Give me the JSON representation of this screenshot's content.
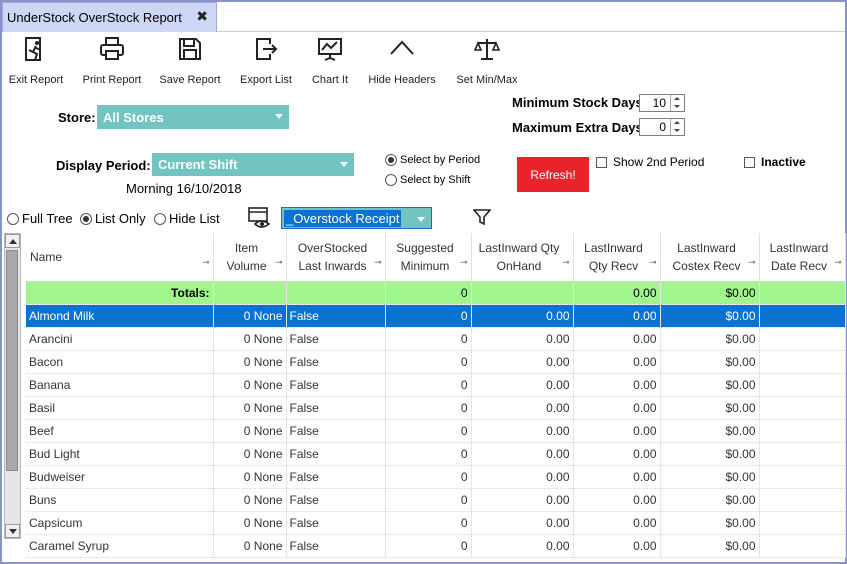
{
  "tab": {
    "title": "UnderStock OverStock Report",
    "close": "✖"
  },
  "toolbar": [
    {
      "label": "Exit Report",
      "icon": "exit-icon"
    },
    {
      "label": "Print Report",
      "icon": "printer-icon"
    },
    {
      "label": "Save Report",
      "icon": "save-icon"
    },
    {
      "label": "Export List",
      "icon": "export-icon"
    },
    {
      "label": "Chart It",
      "icon": "chart-icon"
    },
    {
      "label": "Hide Headers",
      "icon": "chevron-up-icon"
    },
    {
      "label": "Set Min/Max",
      "icon": "scales-icon"
    }
  ],
  "store": {
    "label": "Store:",
    "value": "All Stores"
  },
  "display_period": {
    "label": "Display Period:",
    "value": "Current Shift",
    "shift_text": "Morning 16/10/2018"
  },
  "min_stock_days": {
    "label": "Minimum Stock Days",
    "value": "10"
  },
  "max_extra_days": {
    "label": "Maximum Extra Days",
    "value": "0"
  },
  "period_mode": {
    "by_period": "Select by Period",
    "by_shift": "Select by Shift",
    "selected": "by_period"
  },
  "refresh_label": "Refresh!",
  "show_2nd_period": "Show 2nd Period",
  "inactive": "Inactive",
  "view_mode": {
    "full_tree": "Full Tree",
    "list_only": "List Only",
    "hide_list": "Hide List",
    "selected": "list_only"
  },
  "report_select": {
    "value": "_Overstock Receipt"
  },
  "colors": {
    "accent": "#72c4c2",
    "selection": "#0a73d2",
    "totals": "#a1f58d",
    "refresh": "#e8232b"
  },
  "grid": {
    "columns": [
      "Name",
      "Item Volume",
      "OverStocked Last Inwards",
      "Suggested Minimum",
      "LastInward Qty OnHand",
      "LastInward Qty Recv",
      "LastInward Costex Recv",
      "LastInward Date Recv"
    ],
    "totals": {
      "label": "Totals:",
      "suggested_min": "0",
      "qty_recv": "0.00",
      "costex_recv": "$0.00"
    },
    "rows": [
      {
        "name": "Almond Milk",
        "volume": "0 None",
        "overstocked": "False",
        "sugg_min": "0",
        "qty_onhand": "0.00",
        "qty_recv": "0.00",
        "costex": "$0.00",
        "date": ""
      },
      {
        "name": "Arancini",
        "volume": "0 None",
        "overstocked": "False",
        "sugg_min": "0",
        "qty_onhand": "0.00",
        "qty_recv": "0.00",
        "costex": "$0.00",
        "date": ""
      },
      {
        "name": "Bacon",
        "volume": "0 None",
        "overstocked": "False",
        "sugg_min": "0",
        "qty_onhand": "0.00",
        "qty_recv": "0.00",
        "costex": "$0.00",
        "date": ""
      },
      {
        "name": "Banana",
        "volume": "0 None",
        "overstocked": "False",
        "sugg_min": "0",
        "qty_onhand": "0.00",
        "qty_recv": "0.00",
        "costex": "$0.00",
        "date": ""
      },
      {
        "name": "Basil",
        "volume": "0 None",
        "overstocked": "False",
        "sugg_min": "0",
        "qty_onhand": "0.00",
        "qty_recv": "0.00",
        "costex": "$0.00",
        "date": ""
      },
      {
        "name": "Beef",
        "volume": "0 None",
        "overstocked": "False",
        "sugg_min": "0",
        "qty_onhand": "0.00",
        "qty_recv": "0.00",
        "costex": "$0.00",
        "date": ""
      },
      {
        "name": "Bud Light",
        "volume": "0 None",
        "overstocked": "False",
        "sugg_min": "0",
        "qty_onhand": "0.00",
        "qty_recv": "0.00",
        "costex": "$0.00",
        "date": ""
      },
      {
        "name": "Budweiser",
        "volume": "0 None",
        "overstocked": "False",
        "sugg_min": "0",
        "qty_onhand": "0.00",
        "qty_recv": "0.00",
        "costex": "$0.00",
        "date": ""
      },
      {
        "name": "Buns",
        "volume": "0 None",
        "overstocked": "False",
        "sugg_min": "0",
        "qty_onhand": "0.00",
        "qty_recv": "0.00",
        "costex": "$0.00",
        "date": ""
      },
      {
        "name": "Capsicum",
        "volume": "0 None",
        "overstocked": "False",
        "sugg_min": "0",
        "qty_onhand": "0.00",
        "qty_recv": "0.00",
        "costex": "$0.00",
        "date": ""
      },
      {
        "name": "Caramel Syrup",
        "volume": "0 None",
        "overstocked": "False",
        "sugg_min": "0",
        "qty_onhand": "0.00",
        "qty_recv": "0.00",
        "costex": "$0.00",
        "date": ""
      }
    ]
  }
}
